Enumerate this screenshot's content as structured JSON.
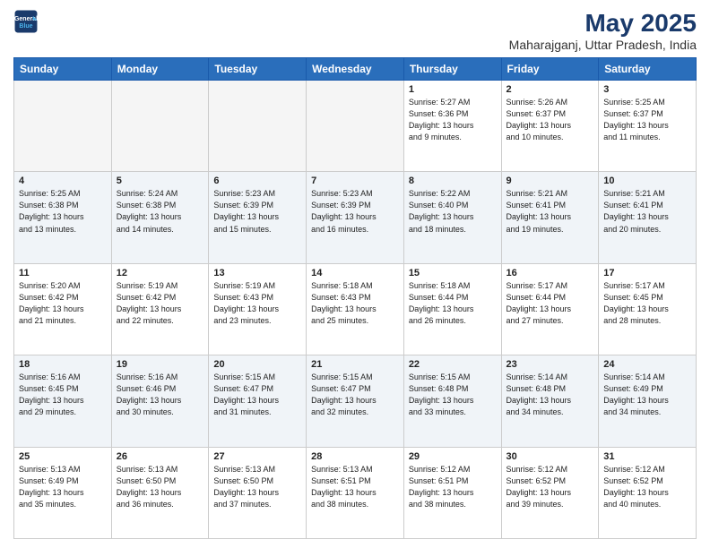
{
  "logo": {
    "line1": "General",
    "line2": "Blue"
  },
  "title": "May 2025",
  "subtitle": "Maharajganj, Uttar Pradesh, India",
  "days_of_week": [
    "Sunday",
    "Monday",
    "Tuesday",
    "Wednesday",
    "Thursday",
    "Friday",
    "Saturday"
  ],
  "weeks": [
    [
      {
        "day": "",
        "info": ""
      },
      {
        "day": "",
        "info": ""
      },
      {
        "day": "",
        "info": ""
      },
      {
        "day": "",
        "info": ""
      },
      {
        "day": "1",
        "info": "Sunrise: 5:27 AM\nSunset: 6:36 PM\nDaylight: 13 hours\nand 9 minutes."
      },
      {
        "day": "2",
        "info": "Sunrise: 5:26 AM\nSunset: 6:37 PM\nDaylight: 13 hours\nand 10 minutes."
      },
      {
        "day": "3",
        "info": "Sunrise: 5:25 AM\nSunset: 6:37 PM\nDaylight: 13 hours\nand 11 minutes."
      }
    ],
    [
      {
        "day": "4",
        "info": "Sunrise: 5:25 AM\nSunset: 6:38 PM\nDaylight: 13 hours\nand 13 minutes."
      },
      {
        "day": "5",
        "info": "Sunrise: 5:24 AM\nSunset: 6:38 PM\nDaylight: 13 hours\nand 14 minutes."
      },
      {
        "day": "6",
        "info": "Sunrise: 5:23 AM\nSunset: 6:39 PM\nDaylight: 13 hours\nand 15 minutes."
      },
      {
        "day": "7",
        "info": "Sunrise: 5:23 AM\nSunset: 6:39 PM\nDaylight: 13 hours\nand 16 minutes."
      },
      {
        "day": "8",
        "info": "Sunrise: 5:22 AM\nSunset: 6:40 PM\nDaylight: 13 hours\nand 18 minutes."
      },
      {
        "day": "9",
        "info": "Sunrise: 5:21 AM\nSunset: 6:41 PM\nDaylight: 13 hours\nand 19 minutes."
      },
      {
        "day": "10",
        "info": "Sunrise: 5:21 AM\nSunset: 6:41 PM\nDaylight: 13 hours\nand 20 minutes."
      }
    ],
    [
      {
        "day": "11",
        "info": "Sunrise: 5:20 AM\nSunset: 6:42 PM\nDaylight: 13 hours\nand 21 minutes."
      },
      {
        "day": "12",
        "info": "Sunrise: 5:19 AM\nSunset: 6:42 PM\nDaylight: 13 hours\nand 22 minutes."
      },
      {
        "day": "13",
        "info": "Sunrise: 5:19 AM\nSunset: 6:43 PM\nDaylight: 13 hours\nand 23 minutes."
      },
      {
        "day": "14",
        "info": "Sunrise: 5:18 AM\nSunset: 6:43 PM\nDaylight: 13 hours\nand 25 minutes."
      },
      {
        "day": "15",
        "info": "Sunrise: 5:18 AM\nSunset: 6:44 PM\nDaylight: 13 hours\nand 26 minutes."
      },
      {
        "day": "16",
        "info": "Sunrise: 5:17 AM\nSunset: 6:44 PM\nDaylight: 13 hours\nand 27 minutes."
      },
      {
        "day": "17",
        "info": "Sunrise: 5:17 AM\nSunset: 6:45 PM\nDaylight: 13 hours\nand 28 minutes."
      }
    ],
    [
      {
        "day": "18",
        "info": "Sunrise: 5:16 AM\nSunset: 6:45 PM\nDaylight: 13 hours\nand 29 minutes."
      },
      {
        "day": "19",
        "info": "Sunrise: 5:16 AM\nSunset: 6:46 PM\nDaylight: 13 hours\nand 30 minutes."
      },
      {
        "day": "20",
        "info": "Sunrise: 5:15 AM\nSunset: 6:47 PM\nDaylight: 13 hours\nand 31 minutes."
      },
      {
        "day": "21",
        "info": "Sunrise: 5:15 AM\nSunset: 6:47 PM\nDaylight: 13 hours\nand 32 minutes."
      },
      {
        "day": "22",
        "info": "Sunrise: 5:15 AM\nSunset: 6:48 PM\nDaylight: 13 hours\nand 33 minutes."
      },
      {
        "day": "23",
        "info": "Sunrise: 5:14 AM\nSunset: 6:48 PM\nDaylight: 13 hours\nand 34 minutes."
      },
      {
        "day": "24",
        "info": "Sunrise: 5:14 AM\nSunset: 6:49 PM\nDaylight: 13 hours\nand 34 minutes."
      }
    ],
    [
      {
        "day": "25",
        "info": "Sunrise: 5:13 AM\nSunset: 6:49 PM\nDaylight: 13 hours\nand 35 minutes."
      },
      {
        "day": "26",
        "info": "Sunrise: 5:13 AM\nSunset: 6:50 PM\nDaylight: 13 hours\nand 36 minutes."
      },
      {
        "day": "27",
        "info": "Sunrise: 5:13 AM\nSunset: 6:50 PM\nDaylight: 13 hours\nand 37 minutes."
      },
      {
        "day": "28",
        "info": "Sunrise: 5:13 AM\nSunset: 6:51 PM\nDaylight: 13 hours\nand 38 minutes."
      },
      {
        "day": "29",
        "info": "Sunrise: 5:12 AM\nSunset: 6:51 PM\nDaylight: 13 hours\nand 38 minutes."
      },
      {
        "day": "30",
        "info": "Sunrise: 5:12 AM\nSunset: 6:52 PM\nDaylight: 13 hours\nand 39 minutes."
      },
      {
        "day": "31",
        "info": "Sunrise: 5:12 AM\nSunset: 6:52 PM\nDaylight: 13 hours\nand 40 minutes."
      }
    ]
  ]
}
